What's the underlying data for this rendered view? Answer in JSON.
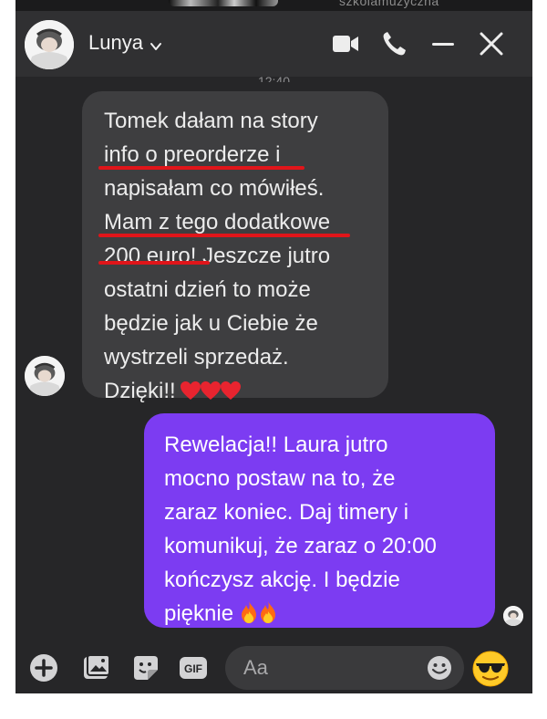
{
  "header": {
    "contact_name": "Lunya",
    "top_strip_text": "szkolamuzyczna"
  },
  "conversation": {
    "timestamp": "12:40",
    "incoming": {
      "lines": [
        "Tomek dałam na story",
        "info o preorderze i",
        "napisałam co mówiłeś.",
        "Mam z tego dodatkowe",
        "200 euro! Jeszcze jutro",
        "ostatni dzień to może",
        "będzie jak u Ciebie że",
        "wystrzeli sprzedaż.",
        "Dzięki!!"
      ],
      "emoji": [
        "red-heart",
        "red-heart",
        "red-heart"
      ]
    },
    "outgoing": {
      "lines": [
        "Rewelacja!! Laura jutro",
        "mocno postaw na to, że",
        "zaraz koniec. Daj timery i",
        "komunikuj, że zaraz o 20:00",
        "kończysz akcję. I będzie",
        "pięknie"
      ],
      "emoji": [
        "fire",
        "fire"
      ]
    }
  },
  "composer": {
    "placeholder": "Aa",
    "icons": [
      "plus-icon",
      "photo-icon",
      "sticker-icon",
      "gif-icon",
      "emoji-icon",
      "sunglasses-emoji"
    ]
  },
  "colors": {
    "background": "#262628",
    "header": "#303032",
    "incoming_bubble": "#3e3e40",
    "outgoing_bubble": "#7c3cf2",
    "underline": "#e0151a"
  }
}
